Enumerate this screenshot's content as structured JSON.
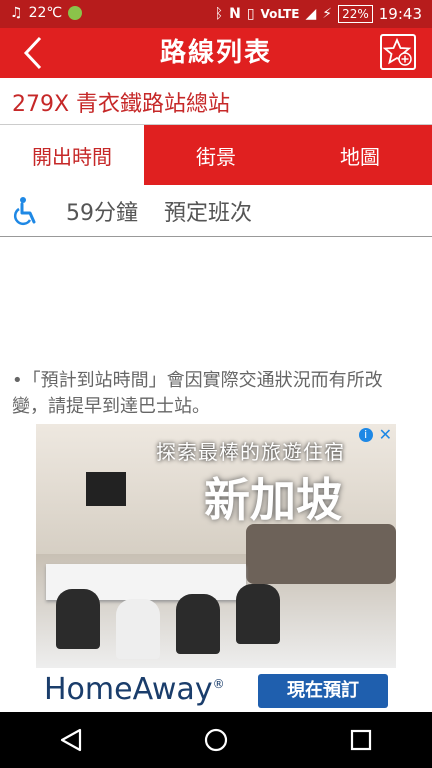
{
  "status_bar": {
    "left_text": "22",
    "left_unit": "℃",
    "battery": "22%",
    "time": "19:43",
    "icons": [
      "music-icon",
      "weather-icon",
      "bluetooth-icon",
      "nfc-icon",
      "vibrate-icon",
      "volte-icon",
      "lte-signal-icon",
      "charging-icon"
    ]
  },
  "app_bar": {
    "title": "路線列表",
    "back_icon": "back-arrow-icon",
    "favorite_icon": "star-add-icon"
  },
  "route": {
    "title": "279X 青衣鐵路站總站"
  },
  "tabs": [
    {
      "label": "開出時間",
      "active": true
    },
    {
      "label": "街景",
      "active": false
    },
    {
      "label": "地圖",
      "active": false
    }
  ],
  "info": {
    "icon": "wheelchair-icon",
    "duration": "59分鐘",
    "schedule_label": "預定班次"
  },
  "note": "•「預計到站時間」會因實際交通狀況而有所改變，請提早到達巴士站。",
  "ad": {
    "headline1": "探索最棒的旅遊住宿",
    "headline2": "新加坡",
    "brand": "HomeAway",
    "brand_mark": "®",
    "cta": "現在預訂",
    "info_glyph": "i",
    "close_glyph": "✕"
  },
  "nav_bar": {
    "icons": [
      "nav-back-icon",
      "nav-home-icon",
      "nav-recents-icon"
    ]
  },
  "colors": {
    "primary": "#e02020",
    "status_bar": "#b71c1c",
    "accent_text": "#c62828",
    "wheelchair_blue": "#1e88e5",
    "ad_button": "#1f5fae"
  }
}
